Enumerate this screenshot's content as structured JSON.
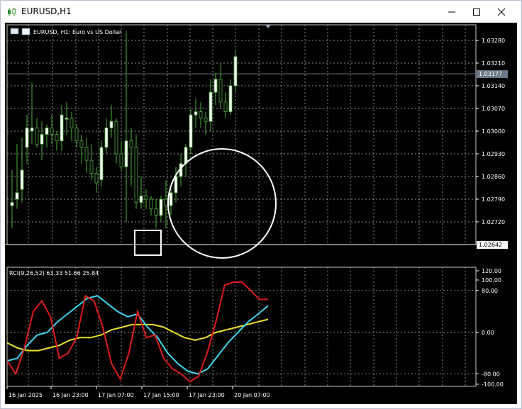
{
  "window": {
    "title": "EURUSD,H1",
    "icons": {
      "app": "candlestick-chart-icon",
      "minimize": "minimize-icon",
      "maximize": "maximize-icon",
      "close": "close-icon"
    }
  },
  "chart": {
    "symbol_header": "EURUSD, H1:  Euro vs US Dollar",
    "header_icons": [
      "flag-icon",
      "chart-window-icon"
    ],
    "price_labels": [
      "1.03280",
      "1.03210",
      "1.03140",
      "1.03070",
      "1.03000",
      "1.02930",
      "1.02860",
      "1.02790",
      "1.02720"
    ],
    "current_price": "1.03177",
    "level_price": "1.02642",
    "time_labels": [
      "16 Jan 2025",
      "16 Jan 23:00",
      "17 Jan 07:00",
      "17 Jan 15:00",
      "17 Jan 23:00",
      "20 Jan 07:00"
    ],
    "colors": {
      "background": "#000000",
      "grid": "#c0c0c0",
      "up_candle": "#ffffff",
      "down_candle": "#000000",
      "wick": "#4caf3a",
      "level_line": "#ffffff",
      "ask_line": "#6a7a8a"
    }
  },
  "indicator": {
    "header": "RCI(9,26,52) 63.33 51.66 25.84",
    "scale_labels": [
      "120.00",
      "100.00",
      "80.00",
      "0.00",
      "-80.00",
      "-100.00"
    ],
    "series": [
      {
        "name": "RCI 9",
        "color": "#e11b1b"
      },
      {
        "name": "RCI 26",
        "color": "#3ed6f0"
      },
      {
        "name": "RCI 52",
        "color": "#ece12a"
      }
    ]
  },
  "annotations": [
    {
      "type": "rectangle",
      "color": "#ffffff"
    },
    {
      "type": "ellipse",
      "color": "#ffffff"
    }
  ]
}
